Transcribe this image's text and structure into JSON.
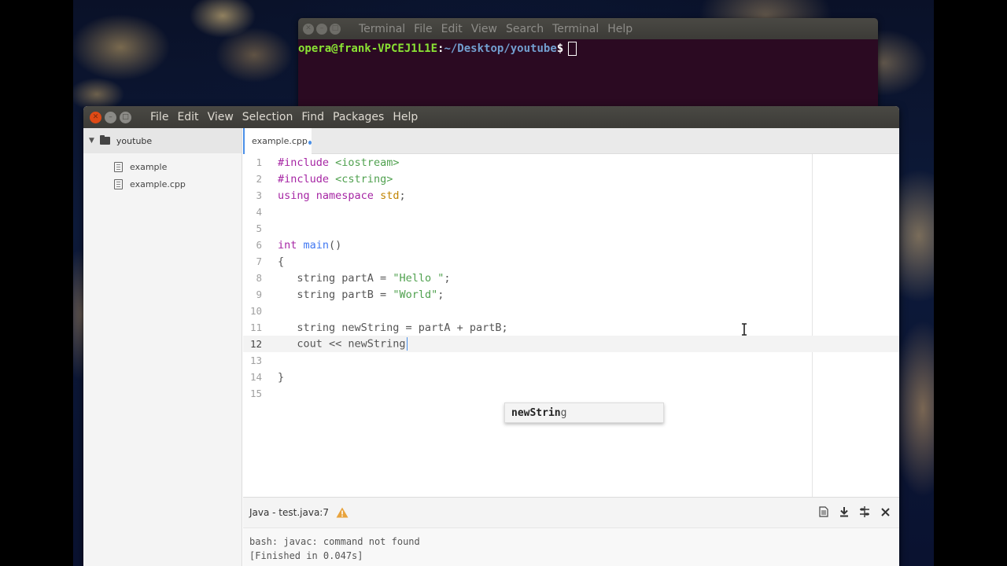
{
  "terminal": {
    "menu": [
      "Terminal",
      "File",
      "Edit",
      "View",
      "Search",
      "Terminal",
      "Help"
    ],
    "prompt_user": "opera@frank-VPCEJ1L1E",
    "prompt_sep": ":",
    "prompt_path": "~/Desktop/youtube",
    "prompt_dollar": "$"
  },
  "atom": {
    "menu": [
      "File",
      "Edit",
      "View",
      "Selection",
      "Find",
      "Packages",
      "Help"
    ],
    "tree": {
      "root": "youtube",
      "files": [
        "example",
        "example.cpp"
      ]
    },
    "tab": "example.cpp",
    "line_numbers": [
      "1",
      "2",
      "3",
      "4",
      "5",
      "6",
      "7",
      "8",
      "9",
      "10",
      "11",
      "12",
      "13",
      "14",
      "15"
    ],
    "code": {
      "l1_kw": "#include",
      "l1_inc": "<iostream>",
      "l2_kw": "#include",
      "l2_inc": "<cstring>",
      "l3_a": "using",
      "l3_b": "namespace",
      "l3_c": "std",
      "l3_d": ";",
      "l6_a": "int",
      "l6_b": "main",
      "l6_c": "()",
      "l7": "{",
      "l8_a": "   string partA = ",
      "l8_b": "\"Hello \"",
      "l8_c": ";",
      "l9_a": "   string partB = ",
      "l9_b": "\"World\"",
      "l9_c": ";",
      "l11": "   string newString = partA + partB;",
      "l12": "   cout << newString",
      "l14": "}"
    },
    "autocomplete": {
      "match": "newStrin",
      "rest": "g"
    },
    "panel": {
      "title": "Java - test.java:7",
      "output": [
        "bash: javac: command not found",
        "[Finished in 0.047s]"
      ]
    }
  },
  "colors": {
    "accent": "#4a8fe7",
    "warning": "#e8a33d",
    "terminal_bg": "#2b0a22"
  }
}
